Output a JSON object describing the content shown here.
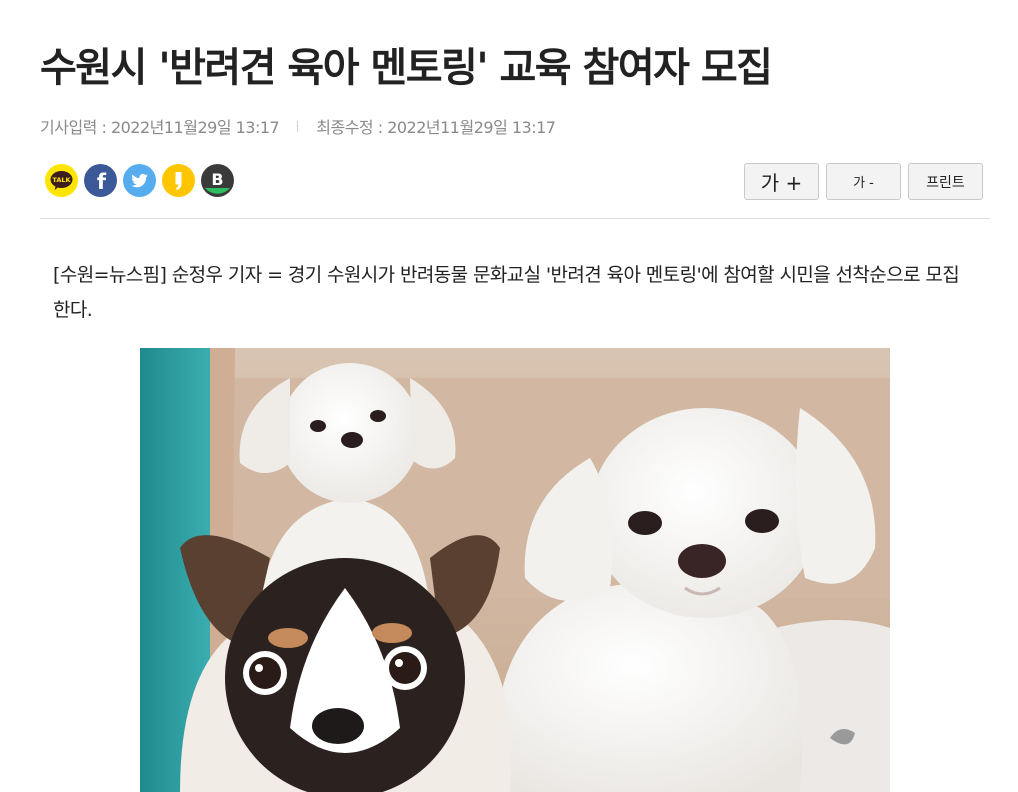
{
  "article": {
    "title": "수원시 '반려견 육아 멘토링' 교육 참여자 모집",
    "published": "기사입력 : 2022년11월29일 13:17",
    "updated": "최종수정 : 2022년11월29일 13:17",
    "lead": "[수원=뉴스핌] 순정우 기자 = 경기 수원시가 반려동물 문화교실 '반려견 육아 멘토링'에 참여할 시민을 선착순으로 모집한다."
  },
  "share": {
    "kakaotalk_label": "TALK",
    "facebook_label": "f",
    "band_label": "B",
    "icons": [
      "kakaotalk-icon",
      "facebook-icon",
      "twitter-icon",
      "kakaostory-icon",
      "band-icon"
    ],
    "colors": {
      "kakaotalk": "#FEE500",
      "facebook": "#3B5998",
      "twitter": "#55ACEE",
      "kakaostory": "#FFC600",
      "band": "#3A3A3A",
      "band_accent": "#2DBE60"
    }
  },
  "tools": {
    "font_up": "가 +",
    "font_down": "가 -",
    "print": "프린트"
  }
}
